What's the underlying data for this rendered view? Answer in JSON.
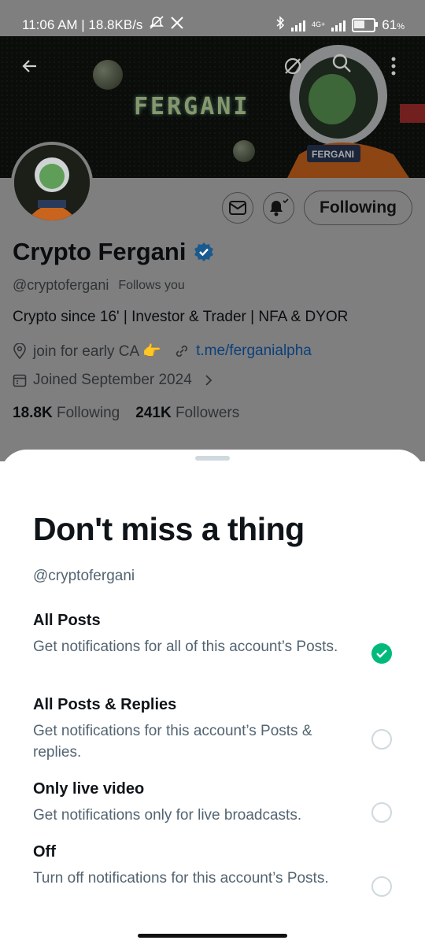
{
  "status_bar": {
    "time_speed": "11:06 AM | 18.8KB/s",
    "network_label": "4G+",
    "battery_text": "61",
    "battery_unit": "%",
    "battery_level": 0.61
  },
  "banner": {
    "title_text": "FERGANI"
  },
  "profile": {
    "following_button": "Following",
    "name": "Crypto Fergani",
    "handle": "@cryptofergani",
    "follows_you": "Follows you",
    "bio": "Crypto since 16' | Investor & Trader | NFA & DYOR",
    "location": "join for early CA 👉",
    "link": "t.me/ferganialpha",
    "joined": "Joined September 2024",
    "following_count": "18.8K",
    "following_label": "Following",
    "followers_count": "241K",
    "followers_label": "Followers"
  },
  "sheet": {
    "title": "Don't miss a thing",
    "subtitle": "@cryptofergani",
    "options": [
      {
        "title": "All Posts",
        "desc": "Get notifications for all of this account’s Posts.",
        "selected": true
      },
      {
        "title": "All Posts & Replies",
        "desc": "Get notifications for this account’s Posts & replies.",
        "selected": false
      },
      {
        "title": "Only live video",
        "desc": "Get notifications only for live broadcasts.",
        "selected": false
      },
      {
        "title": "Off",
        "desc": "Turn off notifications for this account’s Posts.",
        "selected": false
      }
    ]
  },
  "colors": {
    "accent_green": "#00ba7c",
    "verified_blue": "#1d9bf0",
    "link_blue": "#1d9bf0",
    "dim_overlay": "#7f7f7f"
  },
  "icons": [
    "back-arrow-icon",
    "refresh-icon",
    "search-icon",
    "more-icon",
    "mail-icon",
    "bell-icon",
    "location-icon",
    "link-icon",
    "calendar-icon",
    "verified-icon",
    "checkmark-icon"
  ]
}
